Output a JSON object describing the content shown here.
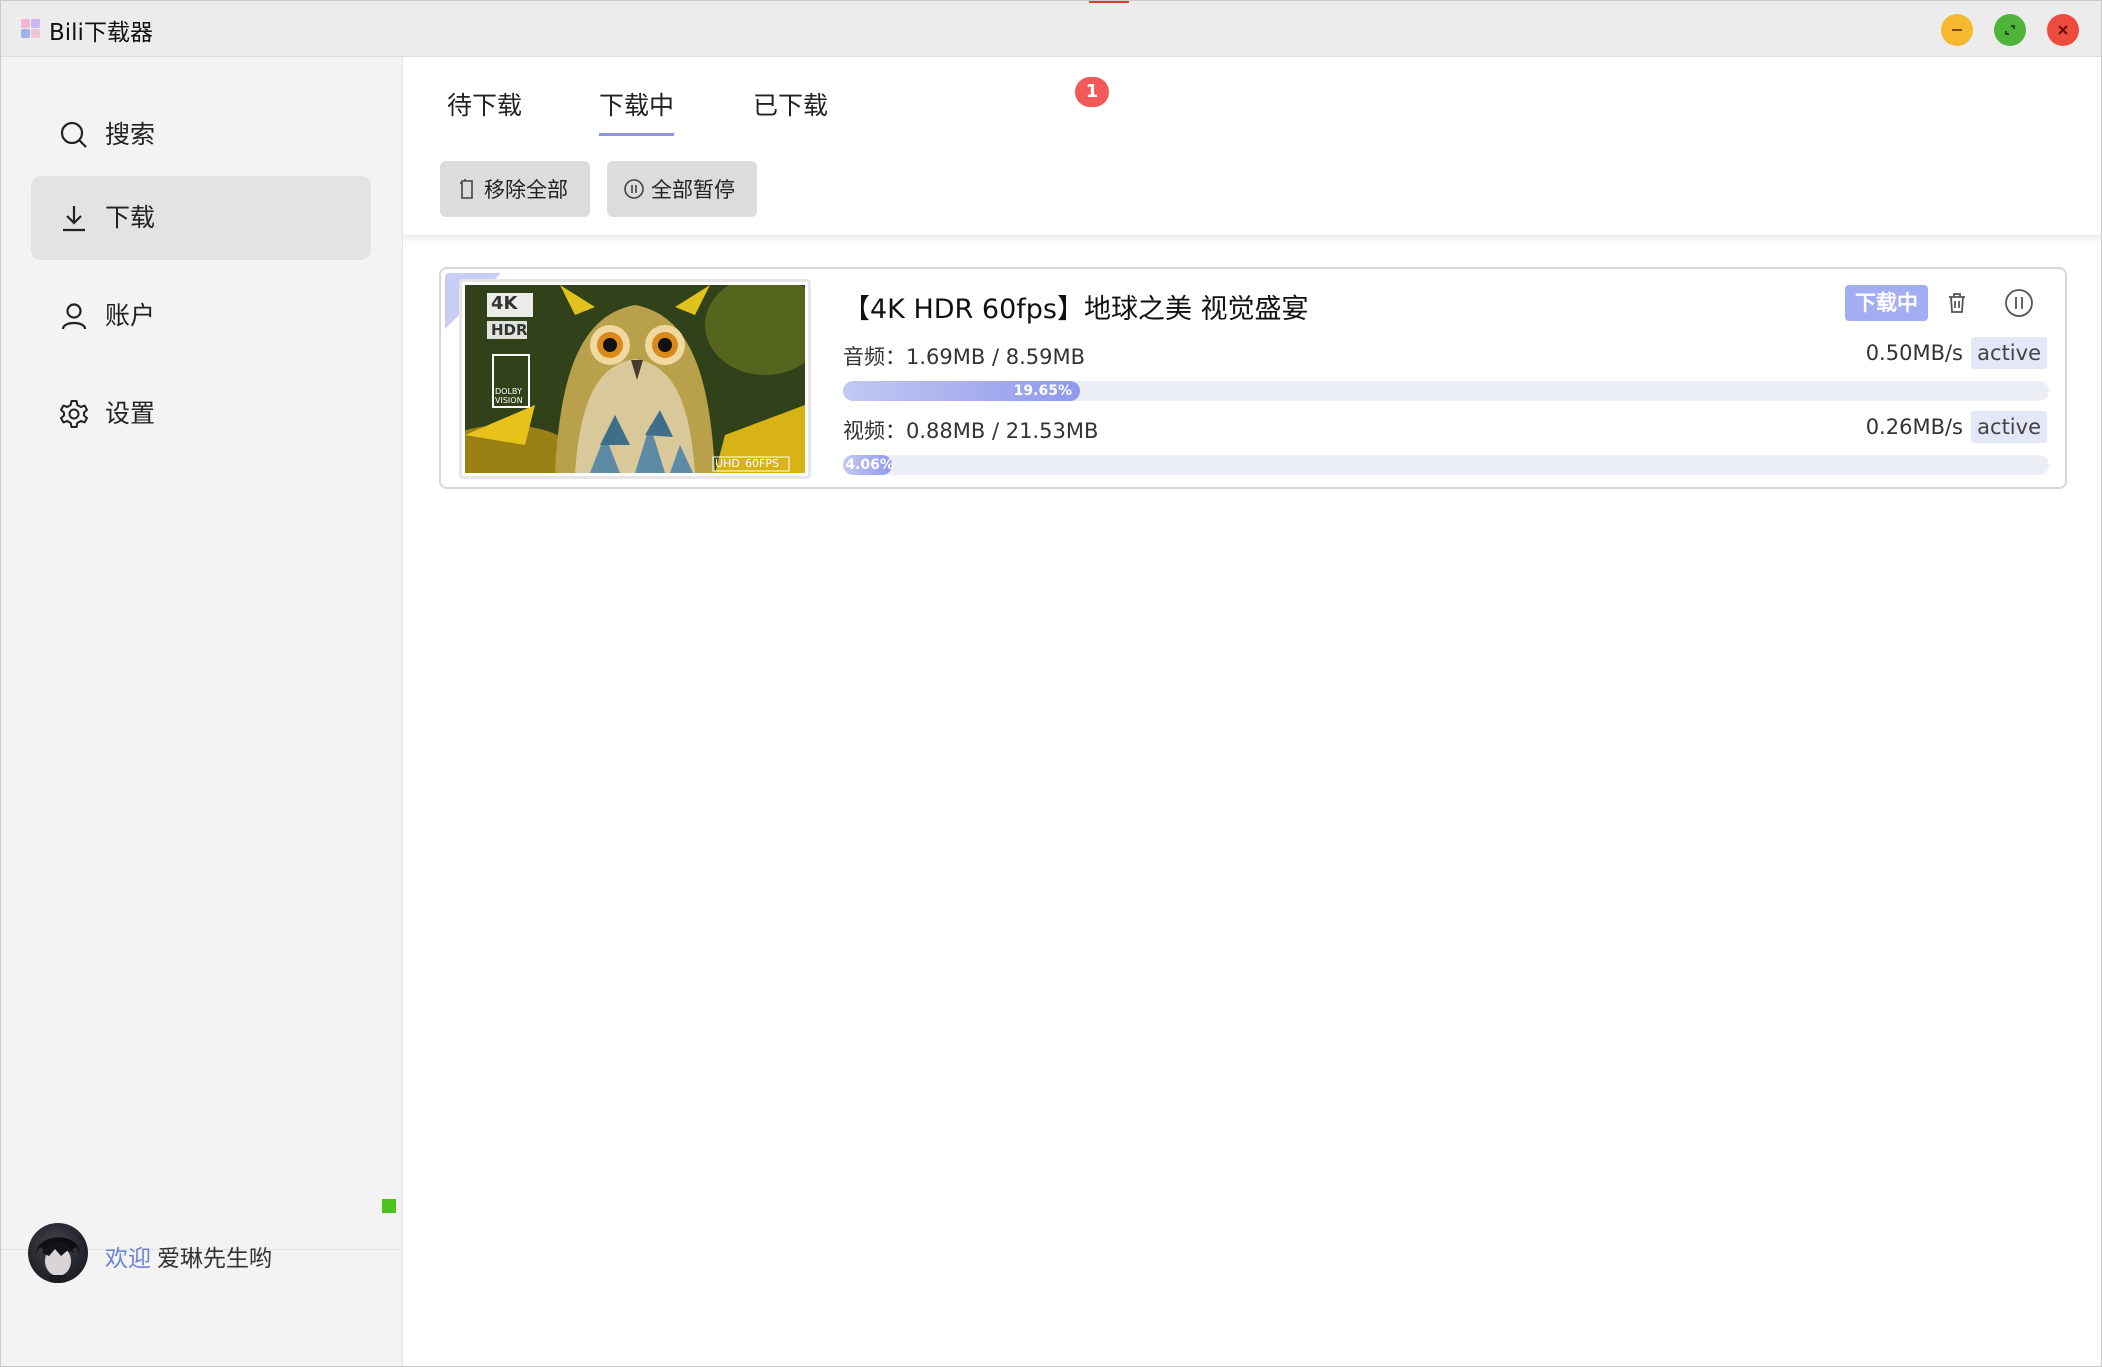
{
  "app": {
    "title": "Bili下载器"
  },
  "sidebar": {
    "items": [
      {
        "label": "搜索",
        "icon": "search-icon"
      },
      {
        "label": "下载",
        "icon": "download-icon"
      },
      {
        "label": "账户",
        "icon": "user-icon"
      },
      {
        "label": "设置",
        "icon": "gear-icon"
      }
    ],
    "active_index": 1,
    "footer": {
      "welcome": "欢迎",
      "username": "爱琳先生哟",
      "online_color": "#4cc31f"
    }
  },
  "tabs": [
    {
      "label": "待下载"
    },
    {
      "label": "下载中",
      "badge": "1"
    },
    {
      "label": "已下载"
    }
  ],
  "active_tab": 1,
  "toolbar": {
    "remove_all": "移除全部",
    "pause_all": "全部暂停"
  },
  "task": {
    "title": "【4K HDR 60fps】地球之美 视觉盛宴",
    "status": "下载中",
    "thumb_text": {
      "k4": "4K",
      "hdr": "HDR",
      "dolby": "DOLBY",
      "vision": "VISION",
      "uhd": "UHD",
      "fps": "60FPS"
    },
    "audio": {
      "label": "音频：1.69MB / 8.59MB",
      "speed": "0.50MB/s",
      "state": "active",
      "progress": 19.65,
      "progress_text": "19.65%"
    },
    "video": {
      "label": "视频：0.88MB / 21.53MB",
      "speed": "0.26MB/s",
      "state": "active",
      "progress": 4.06,
      "progress_text": "4.06%"
    }
  },
  "colors": {
    "accent": "#8e95e6",
    "badge": "#f25a5a",
    "status_pill": "#a3aef2"
  }
}
